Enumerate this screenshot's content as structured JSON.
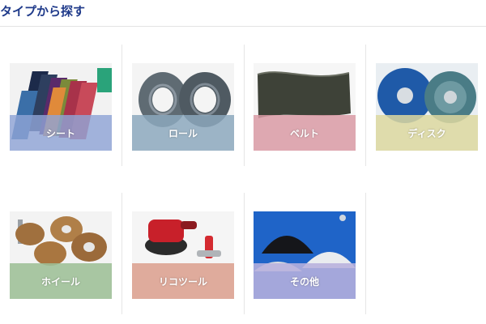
{
  "header": {
    "title": "タイプから探す"
  },
  "categories": [
    {
      "label": "シート",
      "band_color": "#8fa3d6",
      "icon": "abrasive-sheets"
    },
    {
      "label": "ロール",
      "band_color": "#8ca8bd",
      "icon": "abrasive-rolls"
    },
    {
      "label": "ベルト",
      "band_color": "#d99aa5",
      "icon": "sanding-belt"
    },
    {
      "label": "ディスク",
      "band_color": "#ddd8a0",
      "icon": "flap-discs"
    },
    {
      "label": "ホイール",
      "band_color": "#9dbf96",
      "icon": "flap-wheels"
    },
    {
      "label": "リコツール",
      "band_color": "#dca08f",
      "icon": "air-sander-tool"
    },
    {
      "label": "その他",
      "band_color": "#b7b1dd",
      "icon": "abrasive-powder"
    }
  ]
}
